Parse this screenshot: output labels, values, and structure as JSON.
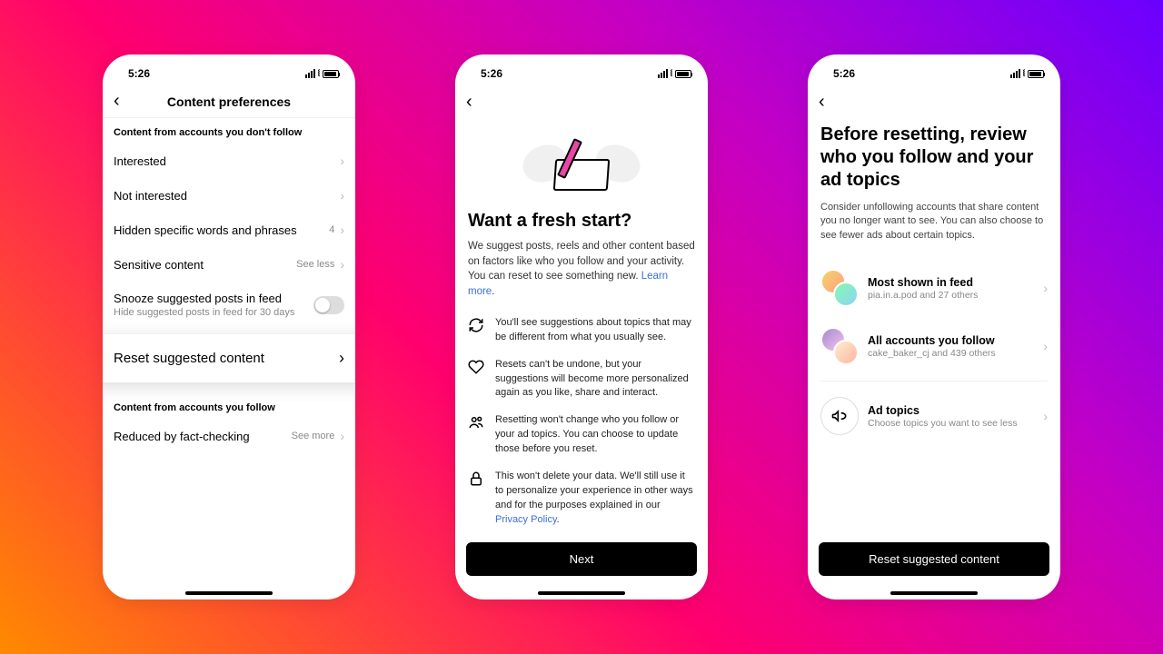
{
  "status_time": "5:26",
  "screen1": {
    "title": "Content preferences",
    "section1": "Content from accounts you don't follow",
    "rows": {
      "interested": "Interested",
      "not_interested": "Not interested",
      "hidden_words": "Hidden specific words and phrases",
      "hidden_count": "4",
      "sensitive": "Sensitive content",
      "sensitive_meta": "See less",
      "snooze_title": "Snooze suggested posts in feed",
      "snooze_sub": "Hide suggested posts in feed for 30 days"
    },
    "highlight": "Reset suggested content",
    "section2": "Content from accounts you follow",
    "reduced": "Reduced by fact-checking",
    "reduced_meta": "See more"
  },
  "screen2": {
    "title": "Want a fresh start?",
    "desc_pre": "We suggest posts, reels and other content based on factors like who you follow and your activity. You can reset to see something new. ",
    "learn_more": "Learn more",
    "period": ".",
    "features": [
      "You'll see suggestions about topics that may be different from what you usually see.",
      "Resets can't be undone, but your suggestions will become more personalized again as you like, share and interact.",
      "Resetting won't change who you follow or your ad topics. You can choose to update those before you reset.",
      "This won't delete your data. We'll still use it to personalize your experience in other ways and for the purposes explained in our "
    ],
    "privacy_policy": "Privacy Policy",
    "next_btn": "Next"
  },
  "screen3": {
    "title": "Before resetting, review who you follow and your ad topics",
    "desc": "Consider unfollowing accounts that share content you no longer want to see. You can also choose to see fewer ads about certain topics.",
    "row1_title": "Most shown in feed",
    "row1_sub": "pia.in.a.pod and 27 others",
    "row2_title": "All accounts you follow",
    "row2_sub": "cake_baker_cj and 439 others",
    "row3_title": "Ad topics",
    "row3_sub": "Choose topics you want to see less",
    "reset_btn": "Reset suggested content"
  }
}
